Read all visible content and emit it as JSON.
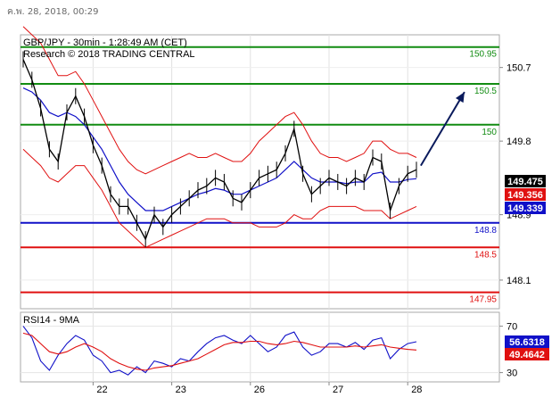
{
  "timestamp": "ค.พ. 28, 2018, 00:29",
  "chart_data": [
    {
      "type": "line",
      "title": "GBP/JPY - 30min - 1:28:49 AM (CET)",
      "subtitle": "Research © 2018 TRADING CENTRAL",
      "ylim": [
        147.75,
        151.1
      ],
      "y_ticks": [
        150.7,
        149.8,
        148.9,
        148.1
      ],
      "y_tick_labels": [
        "150.7",
        "149.8",
        "148.9",
        "148.1"
      ],
      "x_categories": [
        "22",
        "23",
        "26",
        "27",
        "28"
      ],
      "grid": true,
      "levels": [
        {
          "label": "150.95",
          "value": 150.95,
          "color": "#128c12"
        },
        {
          "label": "150.5",
          "value": 150.5,
          "color": "#128c12"
        },
        {
          "label": "150",
          "value": 150.0,
          "color": "#128c12"
        },
        {
          "label": "148.8",
          "value": 148.8,
          "color": "#1010c8"
        },
        {
          "label": "148.5",
          "value": 148.5,
          "color": "#e01010"
        },
        {
          "label": "147.95",
          "value": 147.95,
          "color": "#e01010"
        }
      ],
      "price_tags": [
        {
          "label": "149.475",
          "value": 149.475,
          "color": "#000000"
        },
        {
          "label": "149.356",
          "value": 149.356,
          "color": "#e01010"
        },
        {
          "label": "149.339",
          "value": 149.339,
          "color": "#1010c8"
        }
      ],
      "colors": {
        "price": "#000000",
        "ma": "#1010c8",
        "bands": "#e01010",
        "arrow": "#0a1a5c"
      },
      "price": [
        150.8,
        150.55,
        150.2,
        149.7,
        149.55,
        150.15,
        150.35,
        150.1,
        149.75,
        149.5,
        149.15,
        149.0,
        149.0,
        148.8,
        148.6,
        148.9,
        148.75,
        148.9,
        149.0,
        149.1,
        149.2,
        149.25,
        149.35,
        149.3,
        149.1,
        149.05,
        149.2,
        149.35,
        149.4,
        149.45,
        149.65,
        149.95,
        149.4,
        149.15,
        149.25,
        149.35,
        149.3,
        149.25,
        149.35,
        149.3,
        149.6,
        149.55,
        148.95,
        149.25,
        149.4,
        149.45
      ],
      "ma": [
        150.45,
        150.4,
        150.3,
        150.15,
        150.1,
        150.15,
        150.1,
        150.0,
        149.85,
        149.7,
        149.5,
        149.3,
        149.15,
        149.05,
        148.95,
        148.95,
        148.95,
        149.0,
        149.05,
        149.1,
        149.15,
        149.18,
        149.22,
        149.2,
        149.15,
        149.15,
        149.2,
        149.25,
        149.3,
        149.35,
        149.45,
        149.55,
        149.45,
        149.35,
        149.3,
        149.3,
        149.3,
        149.28,
        149.3,
        149.3,
        149.4,
        149.42,
        149.3,
        149.3,
        149.33,
        149.34
      ],
      "upper_band": [
        151.2,
        151.1,
        151.0,
        150.8,
        150.6,
        150.6,
        150.65,
        150.5,
        150.3,
        150.1,
        149.9,
        149.7,
        149.55,
        149.45,
        149.4,
        149.45,
        149.5,
        149.55,
        149.6,
        149.65,
        149.6,
        149.6,
        149.65,
        149.6,
        149.55,
        149.55,
        149.65,
        149.8,
        149.9,
        150.0,
        150.1,
        150.15,
        150.0,
        149.8,
        149.65,
        149.6,
        149.6,
        149.55,
        149.6,
        149.65,
        149.8,
        149.8,
        149.7,
        149.65,
        149.65,
        149.6
      ],
      "lower_band": [
        149.7,
        149.6,
        149.5,
        149.35,
        149.3,
        149.4,
        149.5,
        149.5,
        149.35,
        149.2,
        149.0,
        148.8,
        148.7,
        148.6,
        148.5,
        148.55,
        148.6,
        148.65,
        148.7,
        148.75,
        148.8,
        148.85,
        148.85,
        148.85,
        148.8,
        148.8,
        148.8,
        148.75,
        148.75,
        148.75,
        148.8,
        148.9,
        148.85,
        148.85,
        148.95,
        149.0,
        149.0,
        149.0,
        149.0,
        148.95,
        148.95,
        148.95,
        148.85,
        148.9,
        148.95,
        149.0
      ],
      "arrow": {
        "from_index": 45.5,
        "from_value": 149.5,
        "to_index": 50.5,
        "to_value": 150.4
      }
    },
    {
      "type": "line",
      "title": "RSI14 - 9MA",
      "ylim": [
        22,
        82
      ],
      "y_ticks": [
        70,
        30
      ],
      "y_tick_labels": [
        "70",
        "30"
      ],
      "price_tags": [
        {
          "label": "56.6318",
          "value": 56.6318,
          "color": "#1010c8"
        },
        {
          "label": "49.4642",
          "value": 49.4642,
          "color": "#e01010"
        }
      ],
      "series": [
        {
          "values": [
            70,
            60,
            40,
            32,
            45,
            55,
            62,
            58,
            45,
            40,
            30,
            32,
            28,
            35,
            30,
            40,
            38,
            35,
            42,
            40,
            48,
            55,
            60,
            62,
            58,
            55,
            62,
            55,
            48,
            52,
            62,
            65,
            52,
            45,
            48,
            55,
            55,
            52,
            56,
            50,
            58,
            60,
            42,
            50,
            55,
            56.6
          ]
        },
        {
          "values": [
            64,
            62,
            55,
            48,
            46,
            48,
            52,
            55,
            52,
            48,
            42,
            38,
            35,
            33,
            32,
            34,
            35,
            36,
            38,
            40,
            42,
            46,
            50,
            54,
            56,
            56,
            57,
            57,
            55,
            54,
            55,
            57,
            56,
            54,
            52,
            52,
            52,
            52,
            53,
            52,
            53,
            54,
            52,
            51,
            50,
            49.5
          ]
        }
      ]
    }
  ]
}
